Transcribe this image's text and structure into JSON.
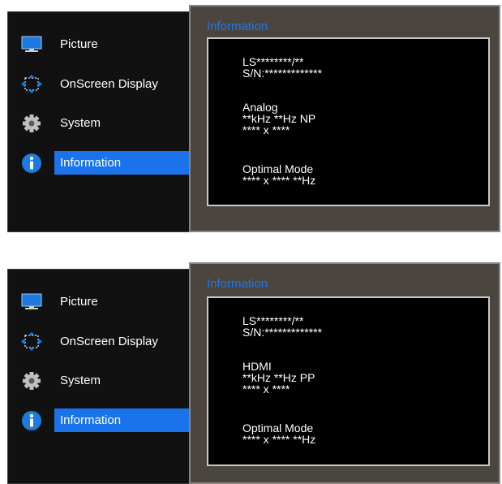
{
  "menu": {
    "items": [
      {
        "label": "Picture",
        "icon": "monitor-icon"
      },
      {
        "label": "OnScreen Display",
        "icon": "move-arrows-icon"
      },
      {
        "label": "System",
        "icon": "gear-icon"
      },
      {
        "label": "Information",
        "icon": "info-icon",
        "selected": true
      }
    ]
  },
  "screens": [
    {
      "panel_title": "Information",
      "model": "LS********/**",
      "serial": "S/N:*************",
      "signal": "Analog",
      "frequency": "**kHz **Hz NP",
      "resolution": "**** x ****",
      "optimal_label": "Optimal Mode",
      "optimal_value": "**** x **** **Hz"
    },
    {
      "panel_title": "Information",
      "model": "LS********/**",
      "serial": "S/N:*************",
      "signal": "HDMI",
      "frequency": "**kHz **Hz PP",
      "resolution": "**** x ****",
      "optimal_label": "Optimal Mode",
      "optimal_value": "**** x **** **Hz"
    }
  ],
  "colors": {
    "accent": "#1a73ea",
    "title": "#1e78e6",
    "menu_bg": "#111111",
    "panel_bg": "#4b4540"
  }
}
